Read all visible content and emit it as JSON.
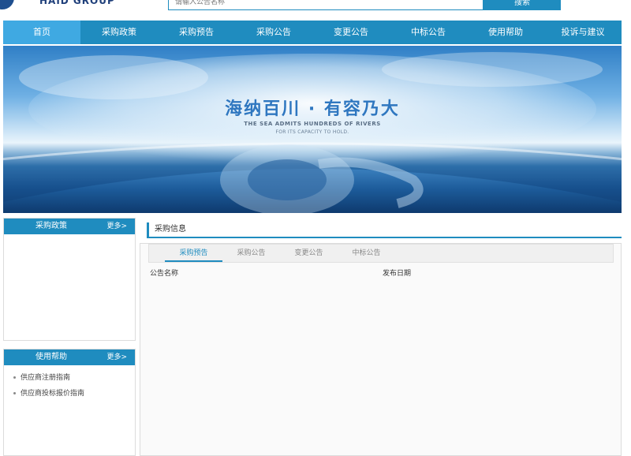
{
  "header": {
    "logo_text": "HAID GROUP",
    "search_placeholder": "请输入公告名称",
    "search_button": "搜索"
  },
  "nav": {
    "items": [
      {
        "label": "首页",
        "active": true
      },
      {
        "label": "采购政策"
      },
      {
        "label": "采购预告"
      },
      {
        "label": "采购公告"
      },
      {
        "label": "变更公告"
      },
      {
        "label": "中标公告"
      },
      {
        "label": "使用帮助"
      },
      {
        "label": "投诉与建议"
      }
    ]
  },
  "banner": {
    "title": "海纳百川 · 有容乃大",
    "subtitle_line1": "THE SEA ADMITS HUNDREDS OF RIVERS",
    "subtitle_line2": "FOR ITS CAPACITY TO HOLD."
  },
  "sidebar": {
    "policy_panel": {
      "title": "采购政策",
      "more": "更多>"
    },
    "help_panel": {
      "title": "使用帮助",
      "more": "更多>",
      "links": [
        "供应商注册指南",
        "供应商投标报价指南"
      ]
    }
  },
  "main": {
    "section_title": "采购信息",
    "tabs": [
      "采购预告",
      "采购公告",
      "变更公告",
      "中标公告"
    ],
    "columns": [
      "公告名称",
      "发布日期"
    ]
  },
  "colors": {
    "accent": "#1f8cbf",
    "nav_active": "#3fa9e2"
  }
}
